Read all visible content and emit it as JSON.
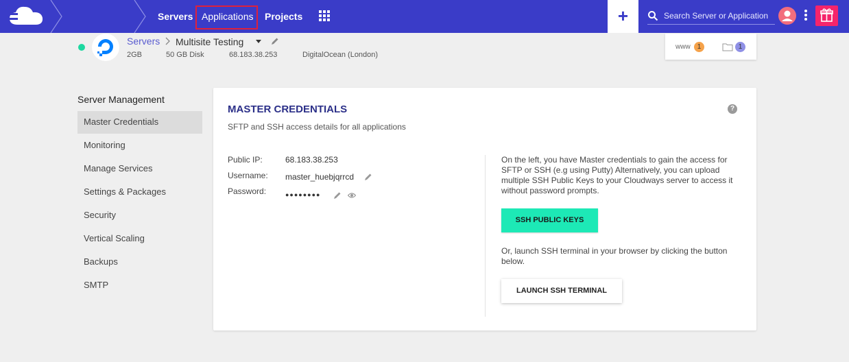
{
  "topbar": {
    "nav": [
      "Servers",
      "Applications",
      "Projects"
    ],
    "add_label": "+",
    "search_placeholder": "Search Server or Application",
    "colors": {
      "bar": "#3a3cc8",
      "gift": "#f5246b",
      "avatar": "#f26d7d",
      "highlight": "#e0203a"
    },
    "icons": [
      "cloudways-logo-icon",
      "apps-grid-icon",
      "search-icon",
      "avatar-icon",
      "kebab-menu-icon",
      "gift-icon"
    ]
  },
  "server": {
    "crumb": "Servers",
    "name": "Multisite Testing",
    "ram": "2GB",
    "disk": "50 GB Disk",
    "ip": "68.183.38.253",
    "provider": "DigitalOcean (London)",
    "status_color": "#1dd8a0",
    "www_label": "www",
    "www_count": "1",
    "folder_count": "1"
  },
  "sidebar": {
    "title": "Server Management",
    "items": [
      "Master Credentials",
      "Monitoring",
      "Manage Services",
      "Settings & Packages",
      "Security",
      "Vertical Scaling",
      "Backups",
      "SMTP"
    ],
    "active": "Master Credentials"
  },
  "card": {
    "title": "MASTER CREDENTIALS",
    "subtitle": "SFTP and SSH access details for all applications",
    "help": "?",
    "labels": {
      "ip": "Public IP:",
      "user": "Username:",
      "pass": "Password:"
    },
    "values": {
      "ip": "68.183.38.253",
      "user": "master_huebjqrrcd",
      "pass": "●●●●●●●●"
    },
    "info_text": "On the left, you have Master credentials to gain the access for SFTP or SSH (e.g using Putty) Alternatively, you can upload multiple SSH Public Keys to your Cloudways server to access it without password prompts.",
    "ssh_keys_button": "SSH PUBLIC KEYS",
    "terminal_text": "Or, launch SSH terminal in your browser by clicking the button below.",
    "terminal_button": "LAUNCH SSH TERMINAL",
    "accent": "#1de9b6"
  }
}
